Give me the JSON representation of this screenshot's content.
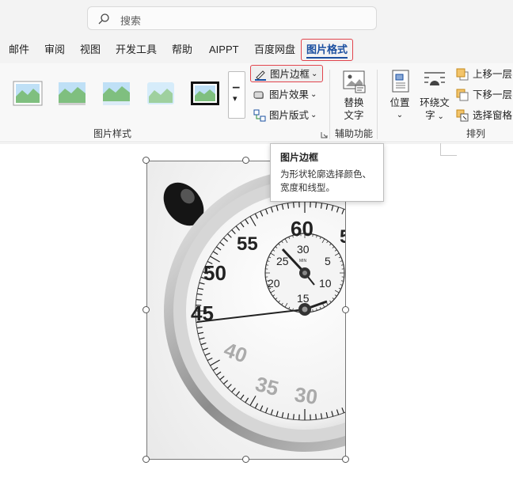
{
  "search": {
    "placeholder": "搜索"
  },
  "tabs": [
    "邮件",
    "审阅",
    "视图",
    "开发工具",
    "帮助",
    "AIPPT",
    "百度网盘",
    "图片格式"
  ],
  "active_tab": "图片格式",
  "ribbon": {
    "styles_group_label": "图片样式",
    "border_label": "图片边框",
    "effects_label": "图片效果",
    "layout_label": "图片版式",
    "alt_text_label_1": "替换",
    "alt_text_label_2": "文字",
    "accessibility_group_label": "辅助功能",
    "position_label": "位置",
    "wrap_text_label_1": "环绕文",
    "wrap_text_label_2": "字",
    "bring_forward_label": "上移一层",
    "send_backward_label": "下移一层",
    "selection_pane_label": "选择窗格",
    "arrange_group_label": "排列"
  },
  "tooltip": {
    "title": "图片边框",
    "description": "为形状轮廓选择颜色、宽度和线型。"
  },
  "stopwatch": {
    "dial_numbers": [
      "60",
      "55",
      "50",
      "45",
      "5"
    ],
    "subdial_numbers": [
      "30",
      "25",
      "20",
      "15",
      "10",
      "5"
    ],
    "subdial_unit": "MIN",
    "blurred_numbers": [
      "40",
      "35",
      "30"
    ]
  },
  "colors": {
    "accent": "#1a4fa0",
    "highlight_border": "#e2444d",
    "ribbon_bg": "#f8f8f8",
    "titlebar_bg": "#f3f3f3"
  }
}
